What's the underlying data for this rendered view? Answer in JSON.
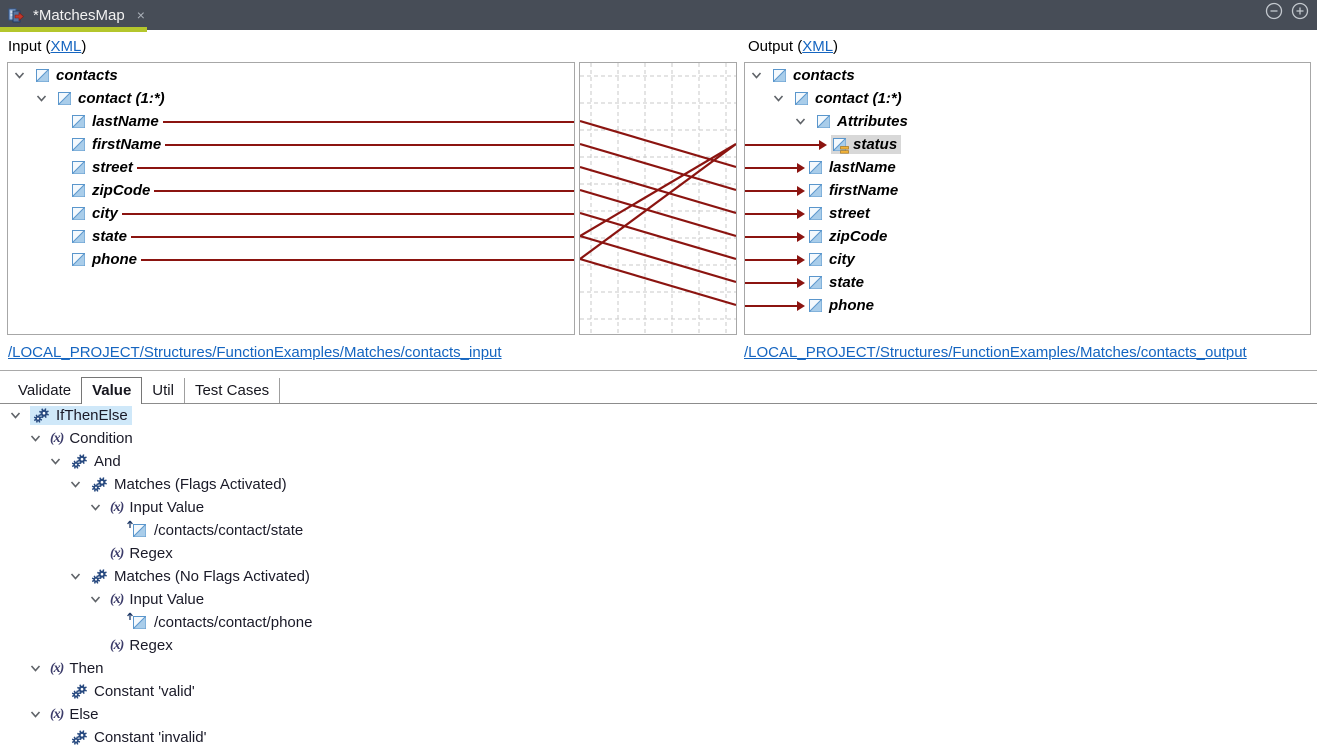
{
  "window": {
    "tab_title": "*MatchesMap",
    "close_glyph": "×"
  },
  "colors": {
    "connection": "#8b1410",
    "link_blue": "#1565c0",
    "tab_accent": "#b4c62c",
    "selection_blue": "#cfe8f9",
    "selection_gray": "#d8d8d8",
    "topbar_bg": "#474d57"
  },
  "input_panel": {
    "header": {
      "prefix": "Input (",
      "link_label": "XML",
      "suffix": ")"
    },
    "path_link": "/LOCAL_PROJECT/Structures/FunctionExamples/Matches/contacts_input",
    "tree": [
      {
        "label": "contacts",
        "level": 0,
        "chevron": true,
        "icon": "element"
      },
      {
        "label": "contact (1:*)",
        "level": 1,
        "chevron": true,
        "icon": "element"
      },
      {
        "label": "lastName",
        "level": 2,
        "icon": "element",
        "line": true
      },
      {
        "label": "firstName",
        "level": 2,
        "icon": "element",
        "line": true
      },
      {
        "label": "street",
        "level": 2,
        "icon": "element",
        "line": true
      },
      {
        "label": "zipCode",
        "level": 2,
        "icon": "element",
        "line": true
      },
      {
        "label": "city",
        "level": 2,
        "icon": "element",
        "line": true
      },
      {
        "label": "state",
        "level": 2,
        "icon": "element",
        "line": true
      },
      {
        "label": "phone",
        "level": 2,
        "icon": "element",
        "line": true
      }
    ]
  },
  "output_panel": {
    "header": {
      "prefix": "Output (",
      "link_label": "XML",
      "suffix": ")"
    },
    "path_link": "/LOCAL_PROJECT/Structures/FunctionExamples/Matches/contacts_output",
    "tree": [
      {
        "label": "contacts",
        "level": 0,
        "chevron": true,
        "icon": "element"
      },
      {
        "label": "contact (1:*)",
        "level": 1,
        "chevron": true,
        "icon": "element"
      },
      {
        "label": "Attributes",
        "level": 2,
        "chevron": true,
        "icon": "element"
      },
      {
        "label": "status",
        "level": 3,
        "icon": "attribute",
        "arrow": true,
        "selected": true
      },
      {
        "label": "lastName",
        "level": 2,
        "icon": "element",
        "arrow": true
      },
      {
        "label": "firstName",
        "level": 2,
        "icon": "element",
        "arrow": true
      },
      {
        "label": "street",
        "level": 2,
        "icon": "element",
        "arrow": true
      },
      {
        "label": "zipCode",
        "level": 2,
        "icon": "element",
        "arrow": true
      },
      {
        "label": "city",
        "level": 2,
        "icon": "element",
        "arrow": true
      },
      {
        "label": "state",
        "level": 2,
        "icon": "element",
        "arrow": true
      },
      {
        "label": "phone",
        "level": 2,
        "icon": "element",
        "arrow": true
      }
    ]
  },
  "connections": [
    {
      "from": "lastName",
      "to": "lastName"
    },
    {
      "from": "firstName",
      "to": "firstName"
    },
    {
      "from": "street",
      "to": "street"
    },
    {
      "from": "zipCode",
      "to": "zipCode"
    },
    {
      "from": "city",
      "to": "city"
    },
    {
      "from": "state",
      "to": "state"
    },
    {
      "from": "phone",
      "to": "phone"
    },
    {
      "from": "state",
      "to": "status"
    },
    {
      "from": "phone",
      "to": "status"
    }
  ],
  "bottom_panel": {
    "tabs": [
      {
        "label": "Validate",
        "active": false
      },
      {
        "label": "Value",
        "active": true
      },
      {
        "label": "Util",
        "active": false
      },
      {
        "label": "Test Cases",
        "active": false
      }
    ],
    "tree": [
      {
        "label": "IfThenElse",
        "level": 0,
        "chevron": true,
        "icon": "gears",
        "selected": true
      },
      {
        "label": "Condition",
        "level": 1,
        "chevron": true,
        "icon": "fx"
      },
      {
        "label": "And",
        "level": 2,
        "chevron": true,
        "icon": "gears"
      },
      {
        "label": "Matches (Flags Activated)",
        "level": 3,
        "chevron": true,
        "icon": "gears"
      },
      {
        "label": "Input Value",
        "level": 4,
        "chevron": true,
        "icon": "fx"
      },
      {
        "label": "/contacts/contact/state",
        "level": 5,
        "icon": "element-ref"
      },
      {
        "label": "Regex",
        "level": 4,
        "icon": "fx"
      },
      {
        "label": "Matches (No Flags Activated)",
        "level": 3,
        "chevron": true,
        "icon": "gears"
      },
      {
        "label": "Input Value",
        "level": 4,
        "chevron": true,
        "icon": "fx"
      },
      {
        "label": "/contacts/contact/phone",
        "level": 5,
        "icon": "element-ref"
      },
      {
        "label": "Regex",
        "level": 4,
        "icon": "fx"
      },
      {
        "label": "Then",
        "level": 1,
        "chevron": true,
        "icon": "fx"
      },
      {
        "label": "Constant 'valid'",
        "level": 2,
        "icon": "gears"
      },
      {
        "label": "Else",
        "level": 1,
        "chevron": true,
        "icon": "fx"
      },
      {
        "label": "Constant 'invalid'",
        "level": 2,
        "icon": "gears"
      }
    ]
  }
}
